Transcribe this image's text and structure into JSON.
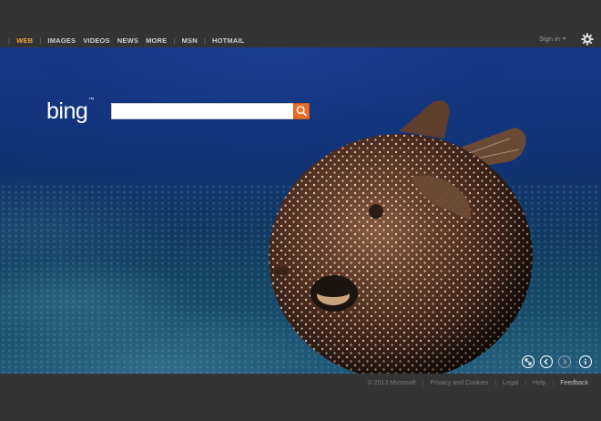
{
  "nav": {
    "items": [
      {
        "label": "WEB",
        "active": true
      },
      {
        "label": "IMAGES"
      },
      {
        "label": "VIDEOS"
      },
      {
        "label": "NEWS"
      },
      {
        "label": "MORE"
      },
      {
        "label": "MSN"
      },
      {
        "label": "HOTMAIL"
      }
    ],
    "separators": [
      "|",
      "|",
      "|"
    ]
  },
  "account": {
    "signin_label": "Sign in",
    "caret": "▾",
    "settings_icon": "gear-icon"
  },
  "search": {
    "logo_text": "bing",
    "logo_tm": "™",
    "input_value": "",
    "button_icon": "search-icon",
    "accent": "#e96d2a"
  },
  "hero": {
    "controls": [
      "expand-icon",
      "previous-icon",
      "next-icon",
      "info-icon"
    ],
    "next_disabled": true
  },
  "footer": {
    "copyright": "© 2013 Microsoft",
    "links": [
      "Privacy and Cookies",
      "Legal",
      "Help"
    ],
    "feedback": "Feedback",
    "sep": "|"
  },
  "colors": {
    "active_nav": "#f2a23a",
    "background": "#343434"
  }
}
